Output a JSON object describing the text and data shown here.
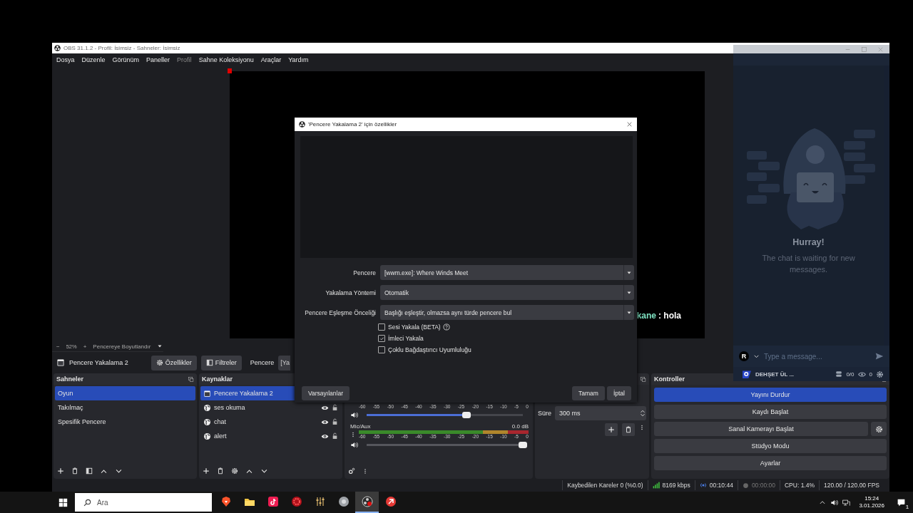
{
  "obs_window": {
    "title": "OBS 31.1.2 - Profil: İsimsiz - Sahneler: İsimsiz",
    "menu": [
      {
        "label": "Dosya",
        "disabled": false
      },
      {
        "label": "Düzenle",
        "disabled": false
      },
      {
        "label": "Görünüm",
        "disabled": false
      },
      {
        "label": "Paneller",
        "disabled": false
      },
      {
        "label": "Profil",
        "disabled": true
      },
      {
        "label": "Sahne Koleksiyonu",
        "disabled": false
      },
      {
        "label": "Araçlar",
        "disabled": false
      },
      {
        "label": "Yardım",
        "disabled": false
      }
    ],
    "preview": {
      "overlay_name": "kane",
      "overlay_message": ": hola"
    },
    "zoom_bar": {
      "minus": "−",
      "zoom": "52%",
      "plus": "+",
      "fit": "Pencereye Boyutlandır"
    },
    "source_toolbar": {
      "source": "Pencere Yakalama 2",
      "properties_button": "Özellikler",
      "filters_button": "Filtreler",
      "window_label": "Pencere",
      "window_value": "[Ya"
    },
    "scenes": {
      "title": "Sahneler",
      "items": [
        {
          "label": "Oyun",
          "selected": true
        },
        {
          "label": "Takılmaç",
          "selected": false
        },
        {
          "label": "Spesifik Pencere",
          "selected": false
        }
      ]
    },
    "sources": {
      "title": "Kaynaklar",
      "items": [
        {
          "label": "Pencere Yakalama 2",
          "kind": "window",
          "selected": true,
          "toggles": false
        },
        {
          "label": "ses okuma",
          "kind": "browser",
          "selected": false,
          "toggles": true
        },
        {
          "label": "chat",
          "kind": "browser",
          "selected": false,
          "toggles": true
        },
        {
          "label": "alert",
          "kind": "browser",
          "selected": false,
          "toggles": true
        }
      ]
    },
    "mixer": {
      "channels": [
        {
          "scale": [
            "-60",
            "-55",
            "-50",
            "-45",
            "-40",
            "-35",
            "-30",
            "-25",
            "-20",
            "-15",
            "-10",
            "-5",
            "0"
          ],
          "level": 0.64
        },
        {
          "name": "Mic/Aux",
          "reading": "0.0 dB",
          "scale": [
            "-60",
            "-55",
            "-50",
            "-45",
            "-40",
            "-35",
            "-30",
            "-25",
            "-20",
            "-15",
            "-10",
            "-5",
            "0"
          ],
          "level": 1.0
        }
      ]
    },
    "transitions": {
      "duration_label": "Süre",
      "duration_value": "300 ms"
    },
    "controls": {
      "title": "Kontroller",
      "buttons": [
        {
          "label": "Yayını Durdur",
          "active": true,
          "settings": false
        },
        {
          "label": "Kaydı Başlat",
          "active": false,
          "settings": false
        },
        {
          "label": "Sanal Kamerayı Başlat",
          "active": false,
          "settings": true
        },
        {
          "label": "Stüdyo Modu",
          "active": false,
          "settings": false
        },
        {
          "label": "Ayarlar",
          "active": false,
          "settings": false
        }
      ]
    },
    "status_bar": {
      "dropped_frames": "Kaybedilen Kareler 0 (%0.0)",
      "bitrate": "8169 kbps",
      "stream_time": "00:10:44",
      "record_time": "00:00:00",
      "cpu": "CPU: 1.4%",
      "fps": "120.00 / 120.00 FPS"
    }
  },
  "chat_window": {
    "heading": "Hurray!",
    "message": "The chat is waiting for new messages.",
    "avatar": "R",
    "placeholder": "Type a message...",
    "channel": "DEHŞET ÜL ...",
    "viewers_ratio": "0/0",
    "viewers": "0"
  },
  "dialog": {
    "title": "'Pencere Yakalama 2' için özellikler",
    "fields": [
      {
        "label": "Pencere",
        "value": "[wwm.exe]: Where Winds Meet"
      },
      {
        "label": "Yakalama Yöntemi",
        "value": "Otomatik"
      },
      {
        "label": "Pencere Eşleşme Önceliği",
        "value": "Başlığı eşleştir, olmazsa aynı türde pencere bul"
      }
    ],
    "checkboxes": [
      {
        "label": "Sesi Yakala (BETA)",
        "checked": false,
        "help": true
      },
      {
        "label": "İmleci Yakala",
        "checked": true,
        "help": false
      },
      {
        "label": "Çoklu Bağdaştırıcı Uyumluluğu",
        "checked": false,
        "help": false
      }
    ],
    "defaults_button": "Varsayılanlar",
    "ok_button": "Tamam",
    "cancel_button": "İptal"
  },
  "taskbar": {
    "search_placeholder": "Ara",
    "apps": [
      {
        "kind": "brave",
        "selected": false
      },
      {
        "kind": "folder",
        "selected": false
      },
      {
        "kind": "tiktok",
        "selected": false
      },
      {
        "kind": "gear-app",
        "selected": false
      },
      {
        "kind": "mixer",
        "selected": false
      },
      {
        "kind": "disc",
        "selected": false
      },
      {
        "kind": "obs",
        "selected": true
      },
      {
        "kind": "red-app",
        "selected": false
      }
    ],
    "time": "15:24",
    "date": "3.01.2026",
    "notifications": "1"
  }
}
